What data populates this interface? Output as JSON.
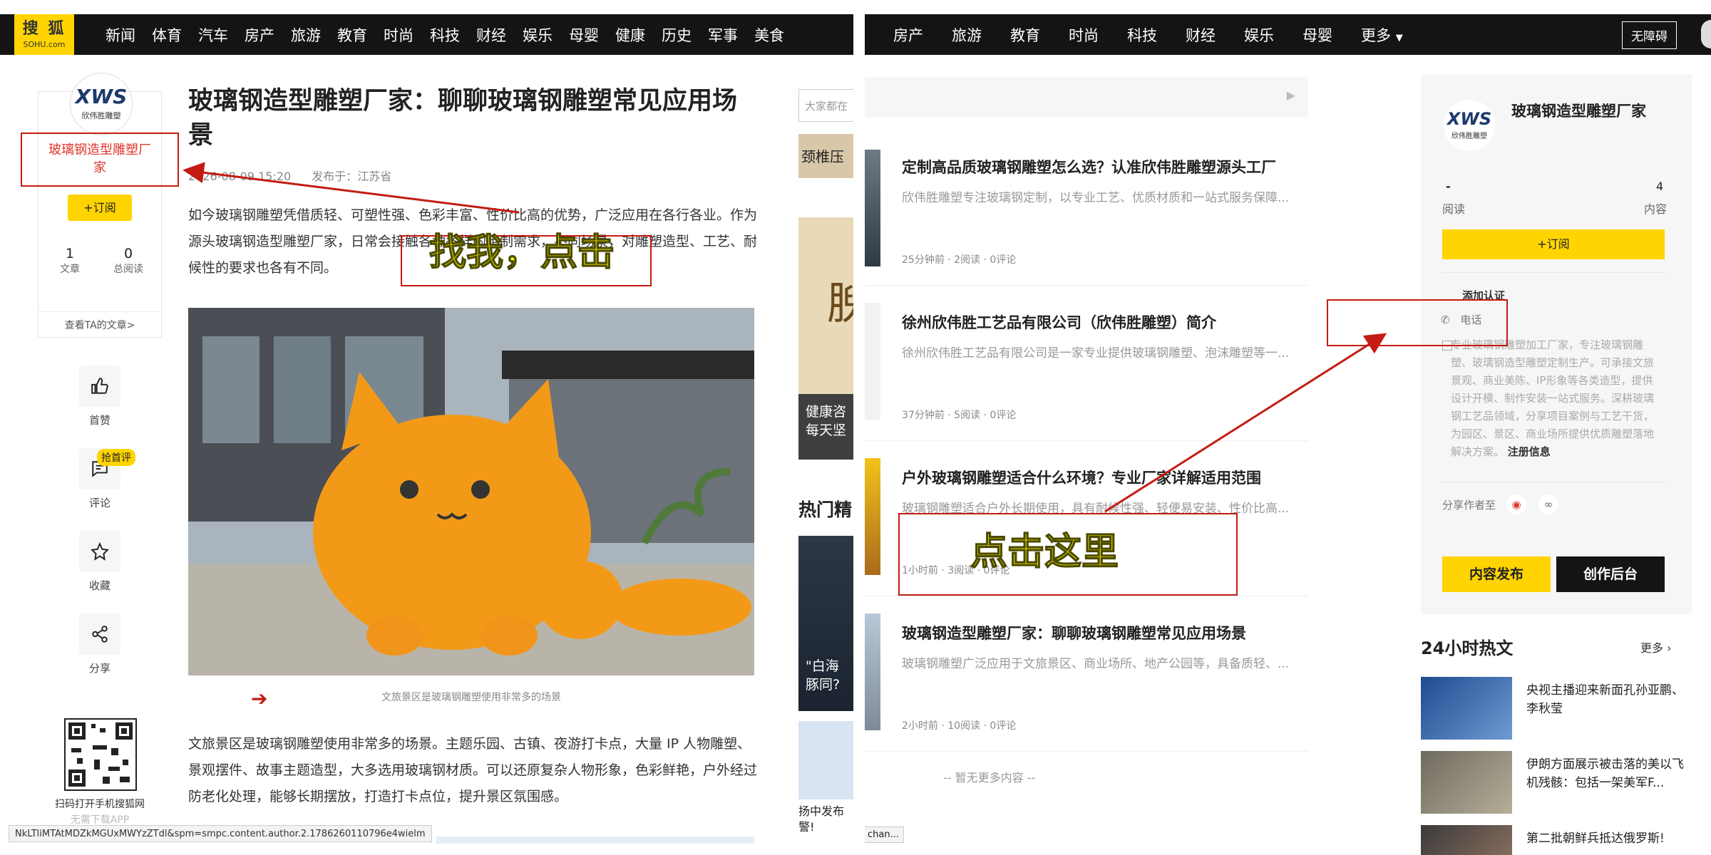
{
  "left": {
    "logo": {
      "main": "搜 狐",
      "sub": "SOHU.com"
    },
    "nav": [
      "新闻",
      "体育",
      "汽车",
      "房产",
      "旅游",
      "教育",
      "时尚",
      "科技",
      "财经",
      "娱乐",
      "母婴",
      "健康",
      "历史",
      "军事",
      "美食"
    ],
    "author": {
      "logo_text": "XWS",
      "logo_sub": "欣伟胜雕塑",
      "name": "玻璃钢造型雕塑厂家",
      "subscribe": "+订阅",
      "articles_value": "1",
      "articles_label": "文章",
      "reads_value": "0",
      "reads_label": "总阅读",
      "view_more": "查看TA的文章>"
    },
    "actions": {
      "like": "首赞",
      "comment": "评论",
      "comment_badge": "抢首评",
      "favorite": "收藏",
      "share": "分享"
    },
    "qr": {
      "text": "扫码打开手机搜狐网",
      "sub": "无需下载APP"
    },
    "article": {
      "title": "玻璃钢造型雕塑厂家：聊聊玻璃钢雕塑常见应用场景",
      "date": "2026-08-09 15:20",
      "published": "发布于：江苏省",
      "p1": "如今玻璃钢雕塑凭借质轻、可塑性强、色彩丰富、性价比高的优势，广泛应用在各行各业。作为源头玻璃钢造型雕塑厂家，日常会接触各种各样的定制需求，不同场景，对雕塑造型、工艺、耐候性的要求也各有不同。",
      "caption": "文旅景区是玻璃钢雕塑使用非常多的场景",
      "p2": "文旅景区是玻璃钢雕塑使用非常多的场景。主题乐园、古镇、夜游打卡点，大量 IP 人物雕塑、景观摆件、故事主题造型，大多选用玻璃钢材质。可以还原复杂人物形象，色彩鲜艳，户外经过防老化处理，能够长期摆放，打造打卡点位，提升景区氛围感。"
    },
    "sidebar": {
      "search_placeholder": "大家都在",
      "ad1": "颈椎压",
      "ad2_big": "腴",
      "ad2_text1": "健康咨",
      "ad2_text2": "每天坚",
      "hot_label": "热门精",
      "news1": "\"白海豚同?",
      "news2": "扬中发布警!"
    },
    "statusbar": "NkLTliMTAtMDZkMGUxMWYzZTdl&spm=smpc.content.author.2.1786260110796e4wielm",
    "annotation": "找我，点击"
  },
  "right": {
    "nav": [
      "房产",
      "旅游",
      "教育",
      "时尚",
      "科技",
      "财经",
      "娱乐",
      "母婴",
      "更多"
    ],
    "accessibility": "无障碍",
    "feed": [
      {
        "title": "定制高品质玻璃钢雕塑怎么选？认准欣伟胜雕塑源头工厂",
        "desc": "欣伟胜雕塑专注玻璃钢定制，以专业工艺、优质材质和一站式服务保障...",
        "meta": "25分钟前 · 2阅读 · 0评论"
      },
      {
        "title": "徐州欣伟胜工艺品有限公司（欣伟胜雕塑）简介",
        "desc": "徐州欣伟胜工艺品有限公司是一家专业提供玻璃钢雕塑、泡沫雕塑等一...",
        "meta": "37分钟前 · 5阅读 · 0评论"
      },
      {
        "title": "户外玻璃钢雕塑适合什么环境？专业厂家详解适用范围",
        "desc": "玻璃钢雕塑适合户外长期使用，具有耐候性强、轻便易安装、性价比高...",
        "meta": "1小时前 · 3阅读 · 0评论"
      },
      {
        "title": "玻璃钢造型雕塑厂家：聊聊玻璃钢雕塑常见应用场景",
        "desc": "玻璃钢雕塑广泛应用于文旅景区、商业场所、地产公园等，具备质轻、...",
        "meta": "2小时前 · 10阅读 · 0评论"
      }
    ],
    "no_more": "-- 暂无更多内容 --",
    "author_card": {
      "logo_text": "XWS",
      "logo_sub": "欣伟胜雕塑",
      "name": "玻璃钢造型雕塑厂家",
      "reads_value": "-",
      "reads_label": "阅读",
      "content_value": "4",
      "content_label": "内容",
      "subscribe": "+订阅",
      "verify": "添加认证",
      "phone": "电话",
      "desc": "专业玻璃钢雕塑加工厂家，专注玻璃钢雕塑、玻璃钢造型雕塑定制生产。可承接文旅景观、商业美陈、IP形象等各类造型，提供设计开模、制作安装一站式服务。深耕玻璃钢工艺品领域，分享项目案例与工艺干货，为园区、景区、商业场所提供优质雕塑落地解决方案。",
      "register": "注册信息",
      "share_label": "分享作者至",
      "publish": "内容发布",
      "studio": "创作后台"
    },
    "hot": {
      "title": "24小时热文",
      "more": "更多",
      "items": [
        "央视主播迎来新面孔孙亚鹏、李秋莹",
        "伊朗方面展示被击落的美以飞机残骸：包括一架美军F...",
        "第二批朝鲜兵抵达俄罗斯!"
      ]
    },
    "statusbar": "chan...",
    "annotation": "点击这里"
  },
  "colors": {
    "accent": "#ffd400",
    "nav_bg": "#141414",
    "annotation_red": "#c41b12"
  }
}
